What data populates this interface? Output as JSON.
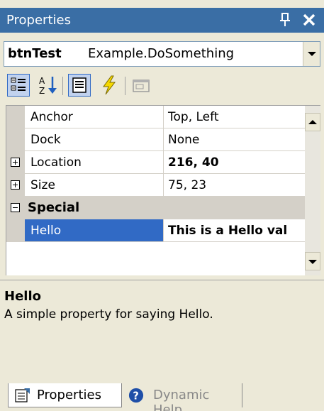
{
  "window": {
    "title": "Properties"
  },
  "object_selector": {
    "name": "btnTest",
    "type": "Example.DoSomething"
  },
  "toolbar": {
    "buttons": [
      {
        "icon": "categorized-icon",
        "pressed": true
      },
      {
        "icon": "alphabetical-icon",
        "pressed": false
      },
      {
        "icon": "properties-icon",
        "pressed": true
      },
      {
        "icon": "events-icon",
        "pressed": false
      },
      {
        "icon": "property-pages-icon",
        "pressed": false
      }
    ]
  },
  "grid": {
    "rows": [
      {
        "name": "Anchor",
        "value": "Top, Left",
        "bold": false,
        "expander": ""
      },
      {
        "name": "Dock",
        "value": "None",
        "bold": false,
        "expander": ""
      },
      {
        "name": "Location",
        "value": "216, 40",
        "bold": true,
        "expander": "plus"
      },
      {
        "name": "Size",
        "value": "75, 23",
        "bold": false,
        "expander": "plus"
      }
    ],
    "category": {
      "name": "Special",
      "expander": "minus"
    },
    "selected_row": {
      "name": "Hello",
      "value": "This is a Hello val"
    }
  },
  "description": {
    "title": "Hello",
    "text": "A simple property for saying Hello."
  },
  "tabs": [
    {
      "label": "Properties",
      "active": true,
      "icon": "properties-tab-icon"
    },
    {
      "label": "Dynamic Help",
      "active": false,
      "icon": "help-icon"
    }
  ],
  "colors": {
    "title_bg": "#3a6ea5",
    "selection": "#316ac5",
    "gutter": "#d4d0c8",
    "chrome": "#ece9d8"
  }
}
